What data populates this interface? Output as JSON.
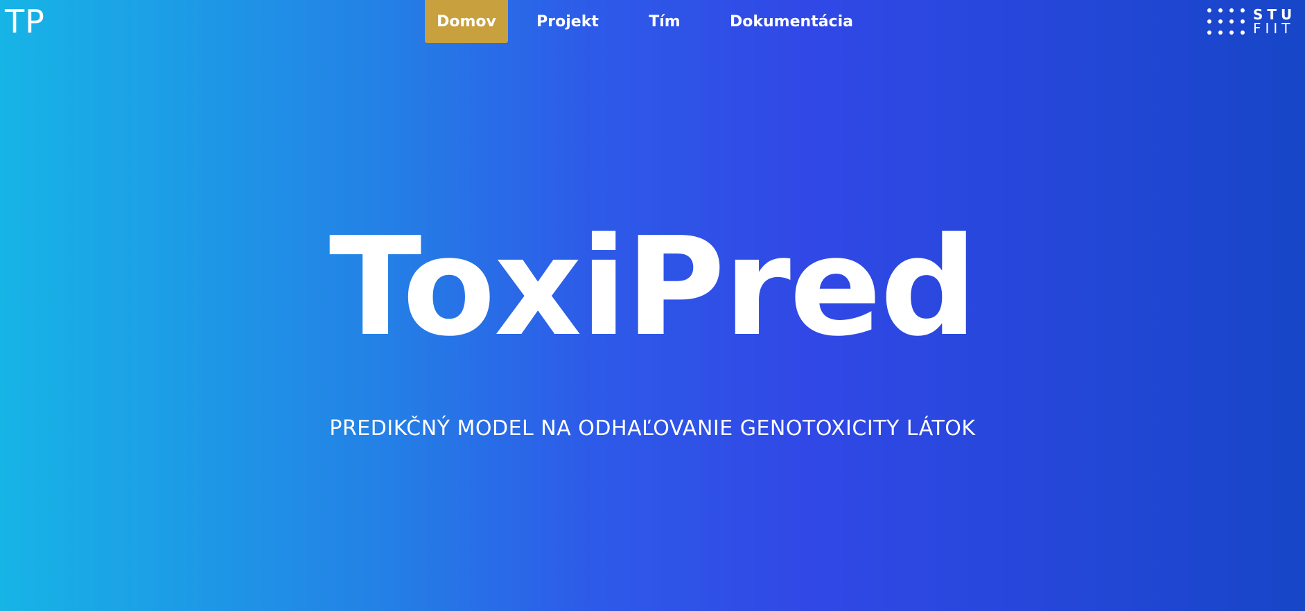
{
  "header": {
    "logo_text": "TP",
    "nav": [
      {
        "label": "Domov",
        "active": true
      },
      {
        "label": "Projekt",
        "active": false
      },
      {
        "label": "Tím",
        "active": false
      },
      {
        "label": "Dokumentácia",
        "active": false
      }
    ],
    "partner_logo": {
      "line1": "STU",
      "line2": "FIIT"
    }
  },
  "hero": {
    "title": "ToxiPred",
    "subtitle": "PREDIKČNÝ MODEL NA ODHAĽOVANIE GENOTOXICITY LÁTOK"
  },
  "colors": {
    "gradient_start": "#17b4e6",
    "gradient_mid": "#3148e6",
    "gradient_end": "#1746c7",
    "nav_active": "#c9a03e",
    "text": "#ffffff"
  }
}
